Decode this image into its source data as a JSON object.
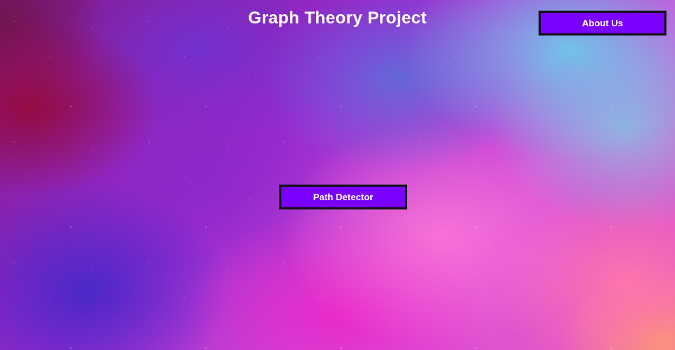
{
  "header": {
    "title": "Graph Theory Project",
    "about_label": "About Us"
  },
  "main": {
    "path_detector_label": "Path Detector"
  },
  "colors": {
    "button_bg": "#7a00ff",
    "button_border": "#111111",
    "text": "#ffffff"
  }
}
